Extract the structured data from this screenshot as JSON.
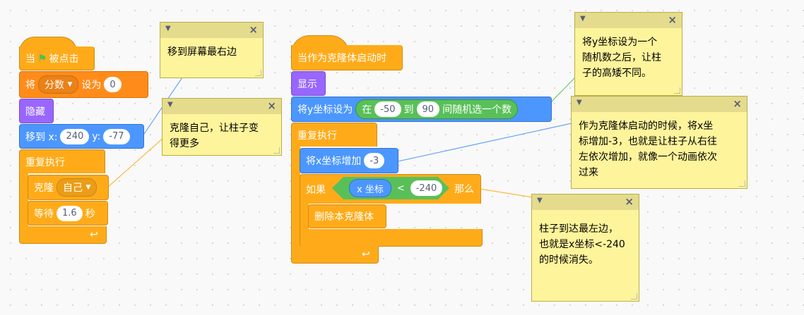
{
  "script1": {
    "hat": {
      "when": "当",
      "flag_icon": "green-flag-icon",
      "clicked": "被点击"
    },
    "set_var": {
      "set": "将",
      "variable": "分数",
      "to": "设为",
      "value": "0"
    },
    "hide": "隐藏",
    "goto": {
      "label": "移到 x:",
      "x": "240",
      "y_label": "y:",
      "y": "-77"
    },
    "forever": "重复执行",
    "clone": {
      "label": "克隆",
      "target": "自己"
    },
    "wait": {
      "label": "等待",
      "value": "1.6",
      "unit": "秒"
    }
  },
  "script2": {
    "hat": "当作为克隆体启动时",
    "show": "显示",
    "set_y": {
      "label": "将y坐标设为",
      "in": "在",
      "from": "-50",
      "to_label": "到",
      "to": "90",
      "rand": "间随机选一个数"
    },
    "forever": "重复执行",
    "change_x": {
      "label": "将x坐标增加",
      "value": "-3"
    },
    "if": {
      "if_label": "如果",
      "reporter": "x 坐标",
      "lt": "<",
      "value": "-240",
      "then": "那么"
    },
    "delete_clone": "删除本克隆体"
  },
  "notes": {
    "n1": "移到屏幕最右边",
    "n2_line1": "克隆自己，让柱子变",
    "n2_line2": "得更多",
    "n3_line1": "将y坐标设为一个",
    "n3_line2": "随机数之后，让柱",
    "n3_line3": "子的高矮不同。",
    "n4_line1": "作为克隆体启动的时候，将x坐",
    "n4_line2": "标增加-3，也就是让柱子从右往",
    "n4_line3": "左依次增加，就像一个动画依次",
    "n4_line4": "过来",
    "n5_line1": "柱子到达最左边，",
    "n5_line2": "也就是x坐标<-240",
    "n5_line3": "的时候消失。"
  },
  "icons": {
    "note_collapse": "chevron-down-icon",
    "note_close": "close-icon",
    "loop": "loop-arrow-icon"
  },
  "colors": {
    "events": "#ffab19",
    "variables": "#ff8c1a",
    "looks": "#9966ff",
    "motion": "#4c97ff",
    "control": "#ffab19",
    "operators": "#59c059",
    "note": "#fef49c"
  }
}
